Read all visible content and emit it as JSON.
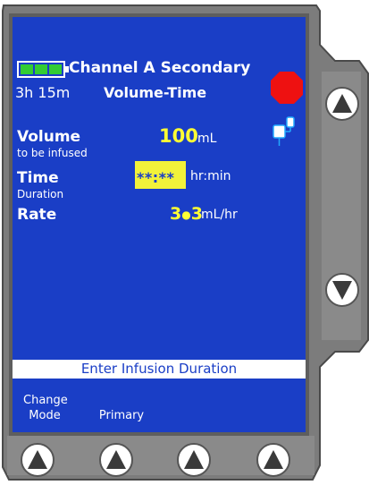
{
  "colors": {
    "screen_bg": "#1a3ec6",
    "accent_yellow": "#ffff33",
    "battery_green": "#33cc33",
    "stop_red": "#ee1111",
    "bezel": "#7a7a7a"
  },
  "header": {
    "battery_icon": "battery-full-icon",
    "channel_title": "Channel A Secondary",
    "time_remaining": "3h 15m",
    "mode": "Volume-Time"
  },
  "status_icons": {
    "stop": "stop-octagon-icon",
    "secondary_bag": "secondary-bag-icon"
  },
  "params": {
    "volume_label": "Volume",
    "volume_sublabel": "to be infused",
    "volume_value": "100",
    "volume_unit": "mL",
    "time_label": "Time",
    "time_sublabel": "Duration",
    "time_value": "**:**",
    "time_unit": "hr:min",
    "rate_label": "Rate",
    "rate_value_int": "3",
    "rate_value_frac": "3",
    "rate_unit": "mL/hr"
  },
  "prompt": "Enter Infusion Duration",
  "softkeys": [
    {
      "line1": "Change",
      "line2": "Mode"
    },
    {
      "line1": "",
      "line2": "Primary"
    },
    {
      "line1": "",
      "line2": ""
    },
    {
      "line1": "",
      "line2": ""
    }
  ],
  "side_keys": {
    "up": "scroll-up-icon",
    "down": "scroll-down-icon"
  }
}
